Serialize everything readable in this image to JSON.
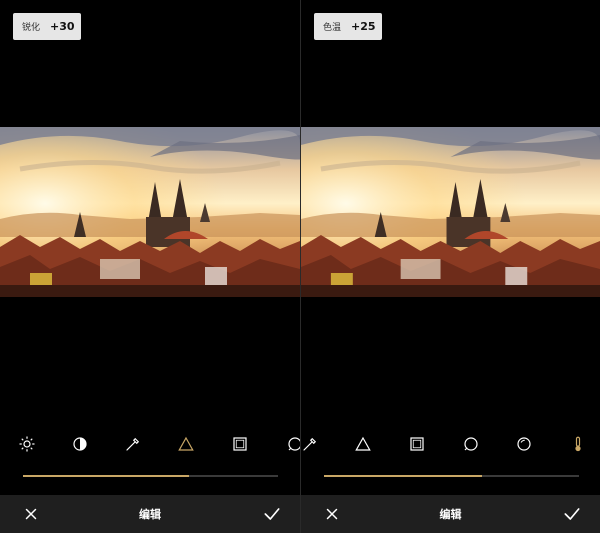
{
  "left": {
    "badge": {
      "label": "锐化",
      "value": "+30"
    },
    "slider": {
      "fill_fraction": 0.65
    },
    "tools": [
      {
        "icon": "brightness-icon",
        "active": false
      },
      {
        "icon": "contrast-icon",
        "active": false
      },
      {
        "icon": "saturation-dropper-icon",
        "active": false
      },
      {
        "icon": "sharpen-triangle-icon",
        "active": true
      },
      {
        "icon": "vignette-square-icon",
        "active": false
      },
      {
        "icon": "shadows-circle-icon",
        "active": false
      }
    ],
    "bottom": {
      "title": "编辑"
    }
  },
  "right": {
    "badge": {
      "label": "色温",
      "value": "+25"
    },
    "slider": {
      "fill_fraction": 0.62
    },
    "tools": [
      {
        "icon": "saturation-dropper-icon",
        "active": false
      },
      {
        "icon": "sharpen-triangle-icon",
        "active": false
      },
      {
        "icon": "vignette-square-icon",
        "active": false
      },
      {
        "icon": "shadows-circle-icon",
        "active": false
      },
      {
        "icon": "highlights-circle-icon",
        "active": false
      },
      {
        "icon": "temperature-icon",
        "active": true
      }
    ],
    "bottom": {
      "title": "编辑"
    }
  },
  "colors": {
    "accent": "#c9a766",
    "bar": "#1f1f1f",
    "inactive_icon": "#ffffff"
  }
}
